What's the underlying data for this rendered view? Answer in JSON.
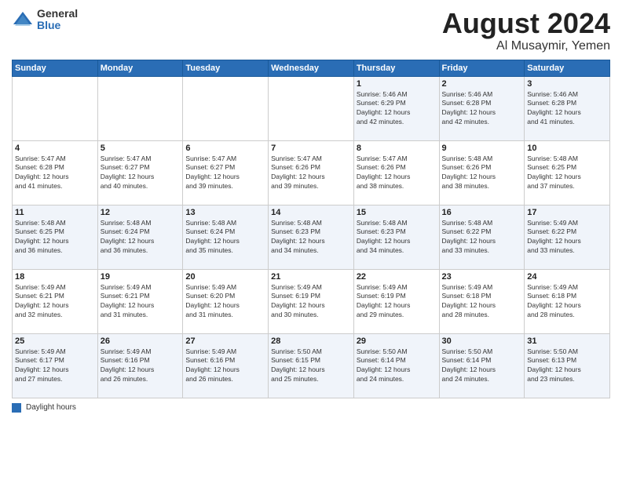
{
  "header": {
    "logo_general": "General",
    "logo_blue": "Blue",
    "month_title": "August 2024",
    "location": "Al Musaymir, Yemen"
  },
  "calendar": {
    "weekdays": [
      "Sunday",
      "Monday",
      "Tuesday",
      "Wednesday",
      "Thursday",
      "Friday",
      "Saturday"
    ],
    "weeks": [
      [
        {
          "day": "",
          "info": ""
        },
        {
          "day": "",
          "info": ""
        },
        {
          "day": "",
          "info": ""
        },
        {
          "day": "",
          "info": ""
        },
        {
          "day": "1",
          "info": "Sunrise: 5:46 AM\nSunset: 6:29 PM\nDaylight: 12 hours\nand 42 minutes."
        },
        {
          "day": "2",
          "info": "Sunrise: 5:46 AM\nSunset: 6:28 PM\nDaylight: 12 hours\nand 42 minutes."
        },
        {
          "day": "3",
          "info": "Sunrise: 5:46 AM\nSunset: 6:28 PM\nDaylight: 12 hours\nand 41 minutes."
        }
      ],
      [
        {
          "day": "4",
          "info": "Sunrise: 5:47 AM\nSunset: 6:28 PM\nDaylight: 12 hours\nand 41 minutes."
        },
        {
          "day": "5",
          "info": "Sunrise: 5:47 AM\nSunset: 6:27 PM\nDaylight: 12 hours\nand 40 minutes."
        },
        {
          "day": "6",
          "info": "Sunrise: 5:47 AM\nSunset: 6:27 PM\nDaylight: 12 hours\nand 39 minutes."
        },
        {
          "day": "7",
          "info": "Sunrise: 5:47 AM\nSunset: 6:26 PM\nDaylight: 12 hours\nand 39 minutes."
        },
        {
          "day": "8",
          "info": "Sunrise: 5:47 AM\nSunset: 6:26 PM\nDaylight: 12 hours\nand 38 minutes."
        },
        {
          "day": "9",
          "info": "Sunrise: 5:48 AM\nSunset: 6:26 PM\nDaylight: 12 hours\nand 38 minutes."
        },
        {
          "day": "10",
          "info": "Sunrise: 5:48 AM\nSunset: 6:25 PM\nDaylight: 12 hours\nand 37 minutes."
        }
      ],
      [
        {
          "day": "11",
          "info": "Sunrise: 5:48 AM\nSunset: 6:25 PM\nDaylight: 12 hours\nand 36 minutes."
        },
        {
          "day": "12",
          "info": "Sunrise: 5:48 AM\nSunset: 6:24 PM\nDaylight: 12 hours\nand 36 minutes."
        },
        {
          "day": "13",
          "info": "Sunrise: 5:48 AM\nSunset: 6:24 PM\nDaylight: 12 hours\nand 35 minutes."
        },
        {
          "day": "14",
          "info": "Sunrise: 5:48 AM\nSunset: 6:23 PM\nDaylight: 12 hours\nand 34 minutes."
        },
        {
          "day": "15",
          "info": "Sunrise: 5:48 AM\nSunset: 6:23 PM\nDaylight: 12 hours\nand 34 minutes."
        },
        {
          "day": "16",
          "info": "Sunrise: 5:48 AM\nSunset: 6:22 PM\nDaylight: 12 hours\nand 33 minutes."
        },
        {
          "day": "17",
          "info": "Sunrise: 5:49 AM\nSunset: 6:22 PM\nDaylight: 12 hours\nand 33 minutes."
        }
      ],
      [
        {
          "day": "18",
          "info": "Sunrise: 5:49 AM\nSunset: 6:21 PM\nDaylight: 12 hours\nand 32 minutes."
        },
        {
          "day": "19",
          "info": "Sunrise: 5:49 AM\nSunset: 6:21 PM\nDaylight: 12 hours\nand 31 minutes."
        },
        {
          "day": "20",
          "info": "Sunrise: 5:49 AM\nSunset: 6:20 PM\nDaylight: 12 hours\nand 31 minutes."
        },
        {
          "day": "21",
          "info": "Sunrise: 5:49 AM\nSunset: 6:19 PM\nDaylight: 12 hours\nand 30 minutes."
        },
        {
          "day": "22",
          "info": "Sunrise: 5:49 AM\nSunset: 6:19 PM\nDaylight: 12 hours\nand 29 minutes."
        },
        {
          "day": "23",
          "info": "Sunrise: 5:49 AM\nSunset: 6:18 PM\nDaylight: 12 hours\nand 28 minutes."
        },
        {
          "day": "24",
          "info": "Sunrise: 5:49 AM\nSunset: 6:18 PM\nDaylight: 12 hours\nand 28 minutes."
        }
      ],
      [
        {
          "day": "25",
          "info": "Sunrise: 5:49 AM\nSunset: 6:17 PM\nDaylight: 12 hours\nand 27 minutes."
        },
        {
          "day": "26",
          "info": "Sunrise: 5:49 AM\nSunset: 6:16 PM\nDaylight: 12 hours\nand 26 minutes."
        },
        {
          "day": "27",
          "info": "Sunrise: 5:49 AM\nSunset: 6:16 PM\nDaylight: 12 hours\nand 26 minutes."
        },
        {
          "day": "28",
          "info": "Sunrise: 5:50 AM\nSunset: 6:15 PM\nDaylight: 12 hours\nand 25 minutes."
        },
        {
          "day": "29",
          "info": "Sunrise: 5:50 AM\nSunset: 6:14 PM\nDaylight: 12 hours\nand 24 minutes."
        },
        {
          "day": "30",
          "info": "Sunrise: 5:50 AM\nSunset: 6:14 PM\nDaylight: 12 hours\nand 24 minutes."
        },
        {
          "day": "31",
          "info": "Sunrise: 5:50 AM\nSunset: 6:13 PM\nDaylight: 12 hours\nand 23 minutes."
        }
      ]
    ]
  },
  "legend": {
    "label": "Daylight hours"
  }
}
